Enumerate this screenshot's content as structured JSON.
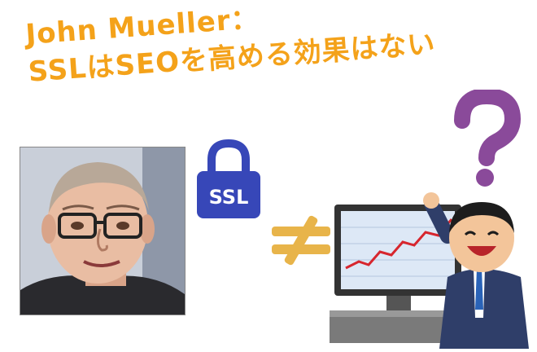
{
  "headline": {
    "line1": "John Mueller：",
    "line2": "SSLはSEOを高める効果はない"
  },
  "ssl_badge": {
    "label": "SSL"
  },
  "colors": {
    "title": "#f4a21a",
    "lock": "#3747b8",
    "neq": "#e8b44a",
    "question": "#8a4a9a"
  }
}
